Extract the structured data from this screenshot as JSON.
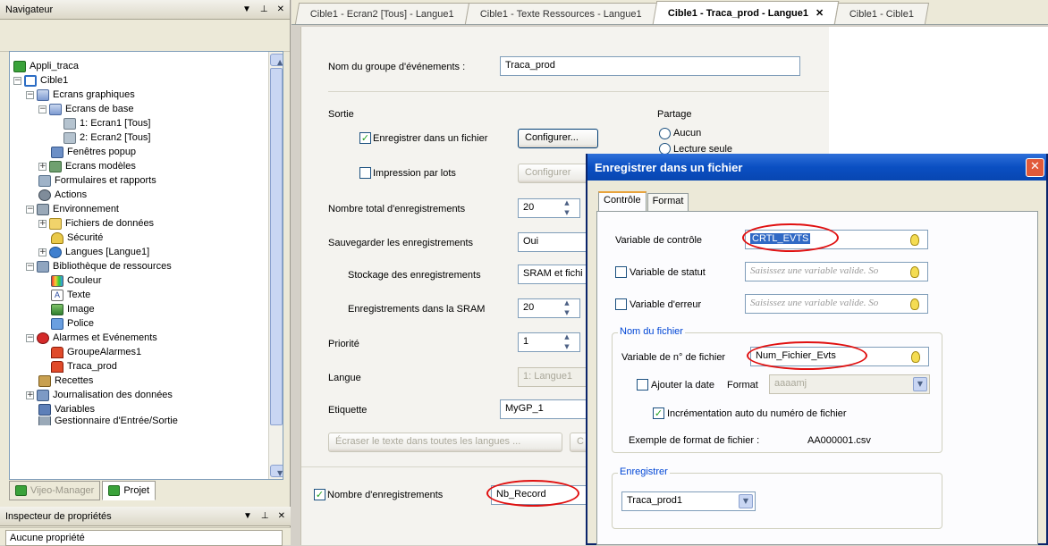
{
  "navigator": {
    "title": "Navigateur",
    "tree": [
      {
        "label": "Appli_traca"
      },
      {
        "label": "Cible1"
      },
      {
        "label": "Ecrans graphiques"
      },
      {
        "label": "Ecrans de base"
      },
      {
        "label": "1: Ecran1 [Tous]"
      },
      {
        "label": "2: Ecran2 [Tous]"
      },
      {
        "label": "Fenêtres popup"
      },
      {
        "label": "Ecrans modèles"
      },
      {
        "label": "Formulaires et rapports"
      },
      {
        "label": "Actions"
      },
      {
        "label": "Environnement"
      },
      {
        "label": "Fichiers de données"
      },
      {
        "label": "Sécurité"
      },
      {
        "label": "Langues [Langue1]"
      },
      {
        "label": "Bibliothèque de ressources"
      },
      {
        "label": "Couleur"
      },
      {
        "label": "Texte"
      },
      {
        "label": "Image"
      },
      {
        "label": "Police"
      },
      {
        "label": "Alarmes et Evénements"
      },
      {
        "label": "GroupeAlarmes1"
      },
      {
        "label": "Traca_prod"
      },
      {
        "label": "Recettes"
      },
      {
        "label": "Journalisation des données"
      },
      {
        "label": "Variables"
      },
      {
        "label": "Gestionnaire d'Entrée/Sortie"
      }
    ],
    "tabs": [
      "Vijeo-Manager",
      "Projet"
    ]
  },
  "properties": {
    "title": "Inspecteur de propriétés",
    "value": "Aucune propriété"
  },
  "doc_tabs": [
    "Cible1 - Ecran2 [Tous] - Langue1",
    "Cible1 - Texte Ressources - Langue1",
    "Cible1 - Traca_prod - Langue1",
    "Cible1 - Cible1"
  ],
  "form": {
    "group_name_label": "Nom du groupe d'événements :",
    "group_name_value": "Traca_prod",
    "sortie_label": "Sortie",
    "partage_label": "Partage",
    "partage_aucun": "Aucun",
    "partage_lecture": "Lecture seule",
    "save_file_label": "Enregistrer dans un fichier",
    "configure_btn": "Configurer...",
    "batch_print_label": "Impression par lots",
    "configure_btn2": "Configurer",
    "total_records_label": "Nombre total d'enregistrements",
    "total_records_value": "20",
    "backup_label": "Sauvegarder les enregistrements",
    "backup_value": "Oui",
    "storage_label": "Stockage des enregistrements",
    "storage_value": "SRAM et fichi",
    "sram_records_label": "Enregistrements dans la SRAM",
    "sram_records_value": "20",
    "priority_label": "Priorité",
    "priority_value": "1",
    "language_label": "Langue",
    "language_value": "1: Langue1",
    "tag_label": "Etiquette",
    "tag_value": "MyGP_1",
    "replace_text_btn": "Écraser le texte dans toutes les langues ...",
    "replace_text_btn2": "C",
    "record_count_label": "Nombre d'enregistrements",
    "record_count_value": "Nb_Record"
  },
  "dialog": {
    "title": "Enregistrer dans un fichier",
    "tabs": [
      "Contrôle",
      "Format"
    ],
    "control_var_label": "Variable de contrôle",
    "control_var_value": "CRTL_EVTS",
    "status_var_label": "Variable de statut",
    "status_var_placeholder": "Saisissez une variable valide. So",
    "error_var_label": "Variable d'erreur",
    "error_var_placeholder": "Saisissez une variable valide. So",
    "filename_group": "Nom du fichier",
    "file_num_var_label": "Variable de n° de fichier",
    "file_num_var_value": "Num_Fichier_Evts",
    "add_date_label": "Ajouter la date",
    "format_label": "Format",
    "format_value": "aaaamj",
    "auto_increment_label": "Incrémentation auto du numéro de fichier",
    "example_label": "Exemple de format de fichier :",
    "example_value": "AA000001.csv",
    "save_group": "Enregistrer",
    "save_value": "Traca_prod1"
  },
  "colors": {
    "title_bar": "#0a4fc2",
    "highlight_ellipse": "#e01010",
    "group_label": "#0046d5"
  }
}
